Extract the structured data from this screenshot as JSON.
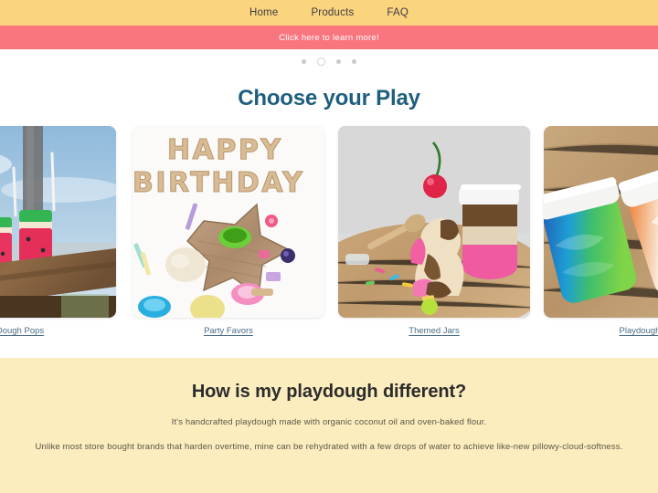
{
  "header": {
    "nav": [
      {
        "label": "Home",
        "active": true
      },
      {
        "label": "Products",
        "active": false
      },
      {
        "label": "FAQ",
        "active": false
      }
    ]
  },
  "promo": {
    "text": "Click here to learn more!",
    "background_color": "#f9767f",
    "text_color": "#ffffff"
  },
  "carousel": {
    "dots": [
      "1",
      "2",
      "3",
      "4"
    ],
    "current_index": 1
  },
  "gallery": {
    "title": "Choose your Play",
    "title_color": "#1f5f7e",
    "cards": [
      {
        "caption": "Dough Pops",
        "image_name": "watermelon-dough-pops-photo",
        "alt": "Watermelon-striped dough pops on sticks lined up on a wooden rail against a blue sky"
      },
      {
        "caption": "Party Favors",
        "image_name": "happy-birthday-party-favors-photo",
        "alt": "Wooden HAPPY BIRTHDAY letters above a star-shaped wooden tray with dough balls and colorful cups"
      },
      {
        "caption": "Themed Jars",
        "image_name": "neapolitan-sundae-themed-jar-photo",
        "alt": "Neapolitan ice cream themed playdough sundae with a cherry on top beside a layered jar on a wood table"
      },
      {
        "caption": "Playdough",
        "image_name": "rainbow-playdough-jars-photo",
        "alt": "Two open jars of blue-green rainbow and orange-cream swirled playdough on a wooden surface"
      }
    ]
  },
  "info": {
    "title": "How is my playdough different?",
    "background_color": "#fbedbe",
    "paragraphs": [
      "It's handcrafted playdough made with organic coconut oil and oven-baked flour.",
      "Unlike most store bought brands that harden overtime, mine can be rehydrated with a few drops of water to achieve like-new pillowy-cloud-softness."
    ]
  }
}
